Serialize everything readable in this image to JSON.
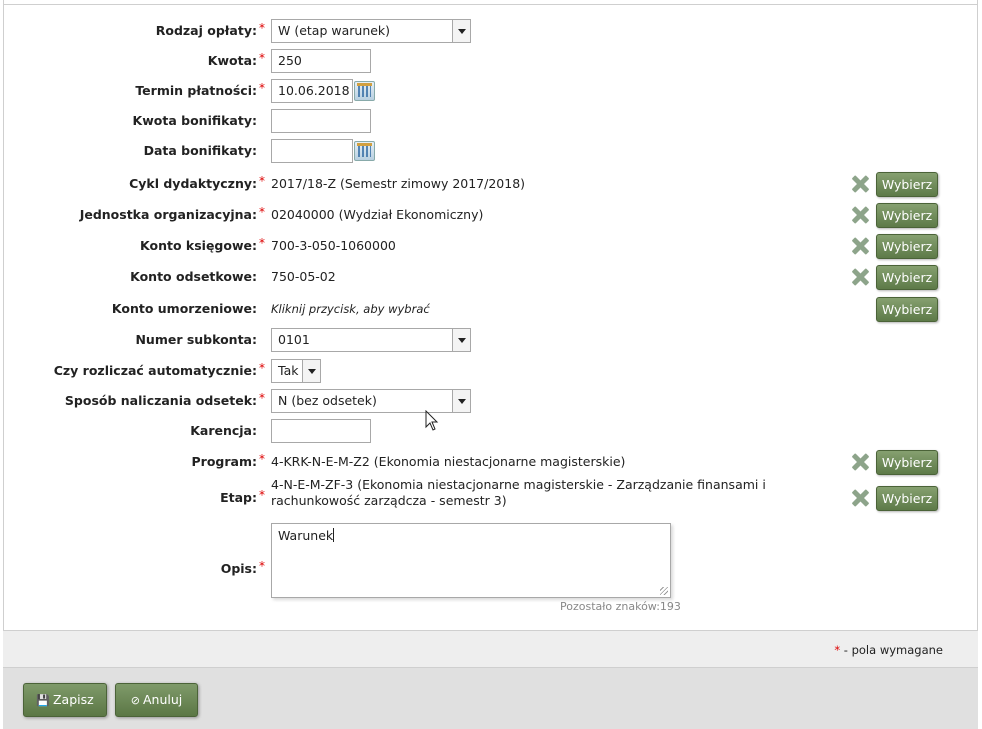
{
  "form": {
    "rodzaj_oplaty": {
      "label": "Rodzaj opłaty:",
      "value": "W (etap warunek)"
    },
    "kwota": {
      "label": "Kwota:",
      "value": "250"
    },
    "termin_platnosci": {
      "label": "Termin płatności:",
      "value": "10.06.2018"
    },
    "kwota_bonifikaty": {
      "label": "Kwota bonifikaty:",
      "value": ""
    },
    "data_bonifikaty": {
      "label": "Data bonifikaty:",
      "value": ""
    },
    "cykl_dydaktyczny": {
      "label": "Cykl dydaktyczny:",
      "value": "2017/18-Z (Semestr zimowy 2017/2018)"
    },
    "jednostka_organizacyjna": {
      "label": "Jednostka organizacyjna:",
      "value": "02040000 (Wydział Ekonomiczny)"
    },
    "konto_ksiegowe": {
      "label": "Konto księgowe:",
      "value": "700-3-050-1060000"
    },
    "konto_odsetkowe": {
      "label": "Konto odsetkowe:",
      "value": "750-05-02"
    },
    "konto_umorzeniowe": {
      "label": "Konto umorzeniowe:",
      "value": "Kliknij przycisk, aby wybrać"
    },
    "numer_subkonta": {
      "label": "Numer subkonta:",
      "value": "0101"
    },
    "czy_rozliczac": {
      "label": "Czy rozliczać automatycznie:",
      "value": "Tak"
    },
    "sposob_naliczania": {
      "label": "Sposób naliczania odsetek:",
      "value": "N (bez odsetek)"
    },
    "karencja": {
      "label": "Karencja:",
      "value": ""
    },
    "program": {
      "label": "Program:",
      "value": "4-KRK-N-E-M-Z2 (Ekonomia niestacjonarne magisterskie)"
    },
    "etap": {
      "label": "Etap:",
      "value_line1": "4-N-E-M-ZF-3 (Ekonomia niestacjonarne magisterskie - Zarządzanie finansami i",
      "value_line2": "rachunkowość zarządcza - semestr 3)"
    },
    "opis": {
      "label": "Opis:",
      "value": "Warunek",
      "counter": "Pozostało znaków:193"
    }
  },
  "buttons": {
    "wybierz": "Wybierz",
    "zapisz": "Zapisz",
    "anuluj": "Anuluj"
  },
  "required_star": "*",
  "required_note": "- pola wymagane",
  "icons": {
    "clear": "clear-x-icon",
    "calendar": "calendar-icon",
    "save": "save-icon",
    "cancel": "cancel-icon",
    "cursor": "mouse-cursor-icon"
  },
  "colors": {
    "button_green": "#6b8757",
    "required_red": "#dd0000",
    "clear_icon": "#8da48a"
  }
}
